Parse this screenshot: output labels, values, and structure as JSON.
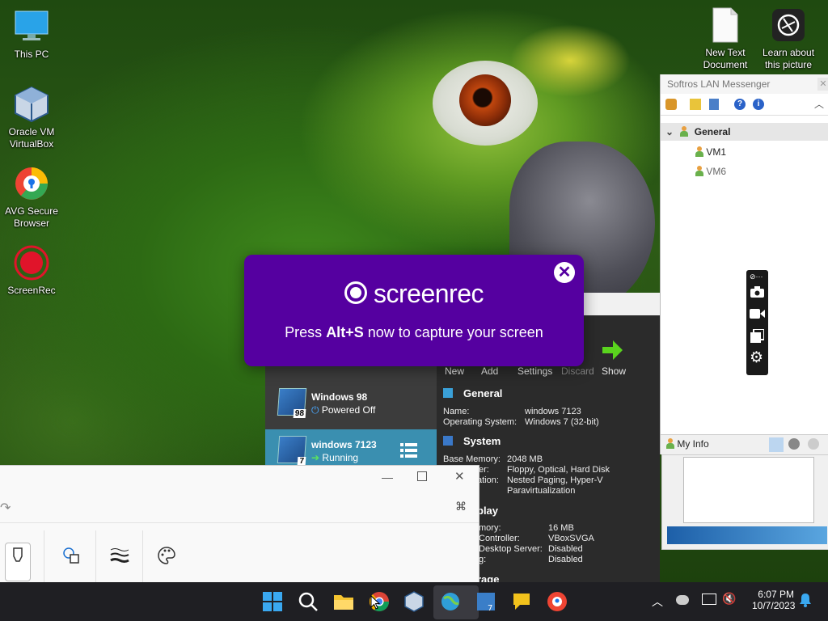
{
  "desktop": {
    "icons": [
      {
        "label": "This PC"
      },
      {
        "label": "Oracle VM VirtualBox"
      },
      {
        "label": "AVG Secure Browser"
      },
      {
        "label": "ScreenRec"
      },
      {
        "label": "New Text Document"
      },
      {
        "label": "Learn about this picture"
      }
    ]
  },
  "screenrec_popup": {
    "logo_text": "screenrec",
    "message_prefix": "Press ",
    "message_shortcut": "Alt+S",
    "message_suffix": " now to capture your screen",
    "close_glyph": "✕"
  },
  "virtualbox": {
    "toolbar": {
      "new": "New",
      "add": "Add",
      "settings": "Settings",
      "discard": "Discard",
      "show": "Show"
    },
    "vms": [
      {
        "name": "Windows 98",
        "state": "Powered Off",
        "badge": "98"
      },
      {
        "name": "windows 7123",
        "state": "Running",
        "badge": "7"
      }
    ],
    "general": {
      "heading": "General",
      "name_label": "Name:",
      "name_value": "windows 7123",
      "os_label": "Operating System:",
      "os_value": "Windows 7 (32-bit)"
    },
    "system": {
      "heading": "System",
      "mem_label": "Base Memory:",
      "mem_value": "2048 MB",
      "boot_label": "er:",
      "boot_value": "Floppy, Optical, Hard Disk",
      "accel_label": "ation:",
      "accel_value1": "Nested Paging, Hyper-V",
      "accel_value2": "Paravirtualization"
    },
    "display": {
      "heading": "play",
      "vmem_label": "mory:",
      "vmem_value": "16 MB",
      "ctrl_label": "Controller:",
      "ctrl_value": "VBoxSVGA",
      "rds_label": "Desktop Server:",
      "rds_value": "Disabled",
      "rec_label": "g:",
      "rec_value": "Disabled"
    },
    "storage_heading": "rage"
  },
  "messenger": {
    "title": "Softros LAN Messenger",
    "group": "General",
    "contacts": [
      "VM1",
      "VM6"
    ],
    "my_info": "My Info"
  },
  "taskbar": {
    "time": "6:07 PM",
    "date": "10/7/2023"
  }
}
